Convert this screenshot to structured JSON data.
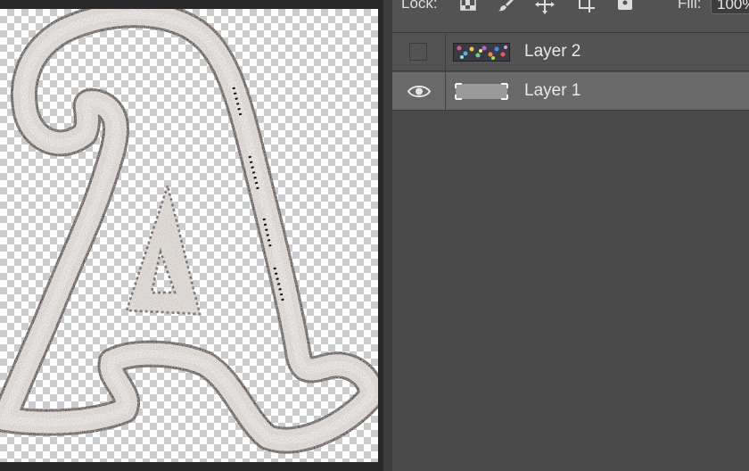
{
  "layers_panel": {
    "lock_label": "Lock:",
    "fill_label": "Fill:",
    "fill_value": "100%",
    "lock_icons": [
      "lock-transparent-pixels-icon",
      "lock-image-pixels-icon",
      "lock-position-icon",
      "prevent-autonest-icon",
      "lock-all-icon"
    ],
    "layers": [
      {
        "name": "Layer 2",
        "visible": false,
        "thumbnail": "colorful-texture-thumbnail",
        "selected": false
      },
      {
        "name": "Layer 1",
        "visible": true,
        "thumbnail": "letter-a-thumbnail",
        "selected": true
      }
    ]
  },
  "canvas": {
    "content": "embroidered-letter-a-with-marching-ants-selection",
    "background": "transparency-checkerboard"
  }
}
